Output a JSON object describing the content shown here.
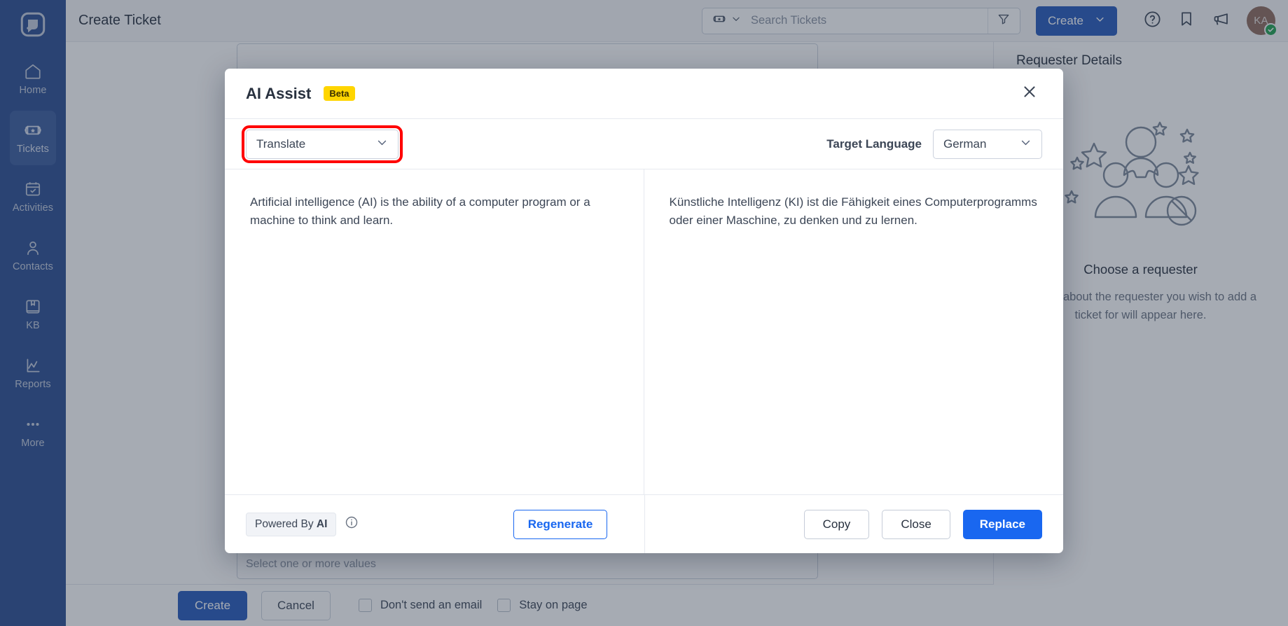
{
  "sidebar": {
    "logo_icon": "app-logo-icon",
    "items": [
      {
        "label": "Home",
        "icon": "home-icon",
        "active": false
      },
      {
        "label": "Tickets",
        "icon": "ticket-icon",
        "active": true
      },
      {
        "label": "Activities",
        "icon": "calendar-check-icon",
        "active": false
      },
      {
        "label": "Contacts",
        "icon": "person-icon",
        "active": false
      },
      {
        "label": "KB",
        "icon": "book-icon",
        "active": false
      },
      {
        "label": "Reports",
        "icon": "chart-line-icon",
        "active": false
      },
      {
        "label": "More",
        "icon": "ellipsis-icon",
        "active": false
      }
    ]
  },
  "topbar": {
    "page_title": "Create Ticket",
    "search": {
      "type_icon": "ticket-icon",
      "type_chevron_icon": "chevron-down-icon",
      "placeholder": "Search Tickets",
      "value": "",
      "filter_icon": "filter-icon"
    },
    "create_button": {
      "label": "Create",
      "chevron_icon": "chevron-down-icon"
    },
    "icons": [
      {
        "name": "help-icon"
      },
      {
        "name": "bookmark-icon"
      },
      {
        "name": "announcement-icon"
      }
    ],
    "avatar": {
      "initials": "KA",
      "status_icon": "check-badge-icon"
    }
  },
  "background_form": {
    "field_top_placeholder": "",
    "field_bottom_placeholder": "Select one or more values"
  },
  "requester_panel": {
    "title": "Requester Details",
    "illustration_icon": "people-empty-state-icon",
    "empty_heading": "Choose a requester",
    "empty_text": "Details about the requester you wish to add a ticket for will appear here."
  },
  "bottom_bar": {
    "create_label": "Create",
    "cancel_label": "Cancel",
    "checkboxes": [
      {
        "label": "Don't send an email",
        "checked": false
      },
      {
        "label": "Stay on page",
        "checked": false
      }
    ]
  },
  "modal": {
    "title": "AI Assist",
    "badge": "Beta",
    "close_icon": "close-icon",
    "action_select": {
      "value": "Translate",
      "chevron_icon": "chevron-down-icon",
      "highlighted": true
    },
    "target_language": {
      "label": "Target Language",
      "value": "German",
      "chevron_icon": "chevron-down-icon"
    },
    "source_text": "Artificial intelligence (AI) is the ability of a computer program or a machine to think and learn.",
    "result_text": "Künstliche Intelligenz (KI) ist die Fähigkeit eines Computerprogramms oder einer Maschine, zu denken und zu lernen.",
    "footer": {
      "powered_by_prefix": "Powered By ",
      "powered_by_brand": "AI",
      "info_icon": "info-icon",
      "regenerate_label": "Regenerate",
      "copy_label": "Copy",
      "close_label": "Close",
      "replace_label": "Replace"
    }
  },
  "colors": {
    "sidebar": "#2a4d91",
    "brand_blue": "#2559bb",
    "accent_blue": "#1967f0",
    "beta_yellow": "#ffd500",
    "highlight_red": "#ff0000",
    "avatar": "#8d6a5c",
    "status_green": "#1fa150"
  }
}
